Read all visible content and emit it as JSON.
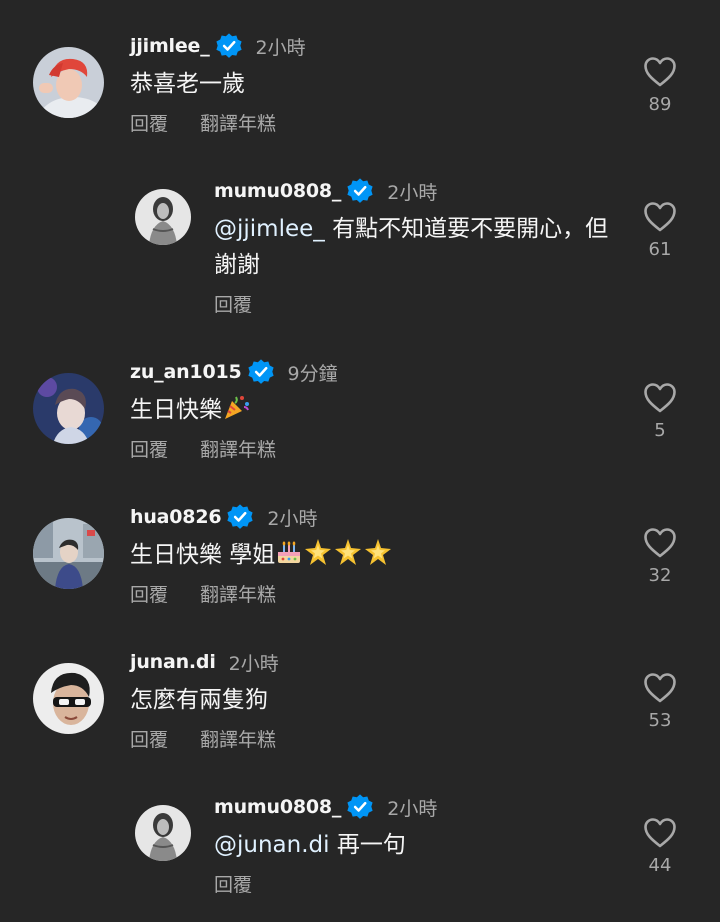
{
  "comments": [
    {
      "username": "jjimlee_",
      "verified": true,
      "time": "2小時",
      "text": "恭喜老一歲",
      "actions": [
        "回覆",
        "翻譯年糕"
      ],
      "likes": "89"
    },
    {
      "username": "mumu0808_",
      "verified": true,
      "time": "2小時",
      "mention": "@jjimlee_",
      "text_line1": " 有點不知道要不要開心，但",
      "text_line2": "謝謝",
      "actions": [
        "回覆"
      ],
      "likes": "61"
    },
    {
      "username": "zu_an1015",
      "verified": true,
      "time": "9分鐘",
      "text": "生日快樂",
      "emoji": "party-popper",
      "actions": [
        "回覆",
        "翻譯年糕"
      ],
      "likes": "5"
    },
    {
      "username": "hua0826",
      "verified": true,
      "time": "2小時",
      "text": "生日快樂 學姐",
      "emoji": "birthday-cake, glowing-star x3",
      "actions": [
        "回覆",
        "翻譯年糕"
      ],
      "likes": "32"
    },
    {
      "username": "junan.di",
      "verified": false,
      "time": "2小時",
      "text": "怎麼有兩隻狗",
      "actions": [
        "回覆",
        "翻譯年糕"
      ],
      "likes": "53"
    },
    {
      "username": "mumu0808_",
      "verified": true,
      "time": "2小時",
      "mention": "@junan.di",
      "text": " 再一句",
      "actions": [
        "回覆"
      ],
      "likes": "44"
    }
  ],
  "colors": {
    "background": "#262626",
    "verified_blue": "#0095f6",
    "secondary_text": "#a8a8a8"
  }
}
